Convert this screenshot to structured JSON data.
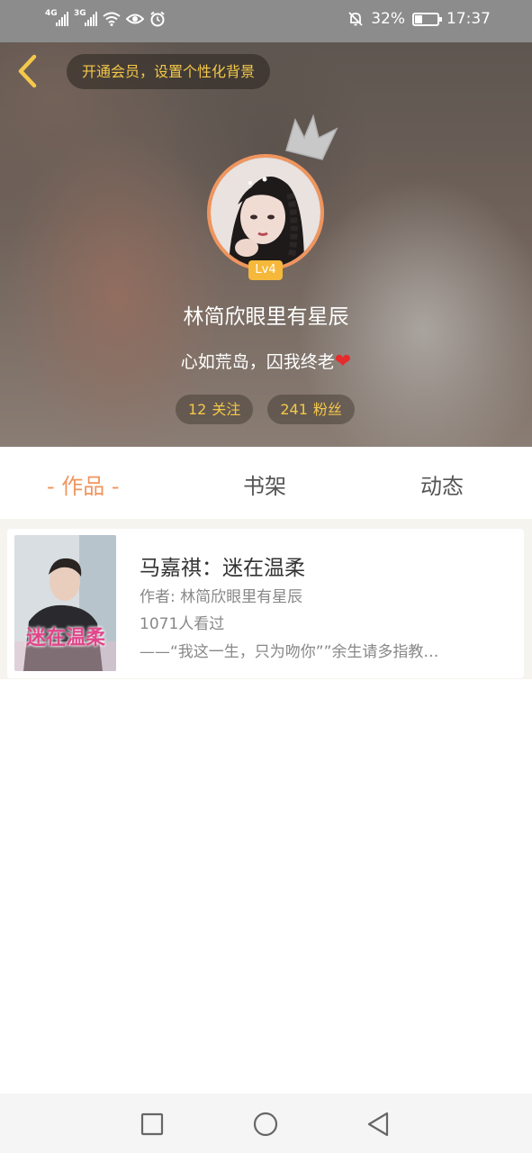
{
  "status_bar": {
    "network1": "4G",
    "network2": "3G",
    "battery_percent": "32%",
    "battery_level": 0.32,
    "time": "17:37"
  },
  "header": {
    "vip_banner": "开通会员，设置个性化背景",
    "level": "Lv4",
    "username": "林简欣眼里有星辰",
    "signature": "心如荒岛，囚我终老",
    "heart_glyph": "❤",
    "following_count": "12",
    "following_label": "关注",
    "followers_count": "241",
    "followers_label": "粉丝",
    "accent_color": "#f4c84a"
  },
  "tabs": {
    "works": "- 作品 -",
    "shelf": "书架",
    "feed": "动态",
    "active_color": "#f0955e"
  },
  "works": [
    {
      "cover_text": "迷在温柔",
      "title": "马嘉祺：迷在温柔",
      "author": "作者: 林简欣眼里有星辰",
      "views": "1071人看过",
      "description": "——“我这一生，只为吻你””余生请多指教…"
    }
  ],
  "icons": {
    "back": "chevron-left-icon",
    "crown": "crown-icon",
    "nav_recent": "square-icon",
    "nav_home": "circle-icon",
    "nav_back": "triangle-back-icon"
  }
}
